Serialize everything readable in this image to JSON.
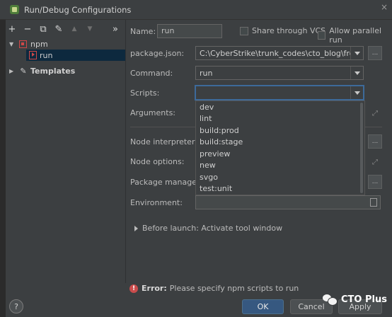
{
  "window": {
    "title": "Run/Debug Configurations",
    "close": "×"
  },
  "toolbar": {
    "add": "+",
    "remove": "−",
    "copy": "⧉",
    "edit": "✎",
    "up": "▲",
    "down": "▼",
    "more": "»"
  },
  "tree": {
    "group_label": "npm",
    "config_label": "run",
    "templates_label": "Templates"
  },
  "form": {
    "name_label": "Name:",
    "name_value": "run",
    "share_label": "Share through VCS",
    "parallel_label": "Allow parallel run",
    "package_json_label": "package.json:",
    "package_json_value": "C:\\CyberStrike\\trunk_codes\\cto_blog\\frontend\\p",
    "command_label": "Command:",
    "command_value": "run",
    "scripts_label": "Scripts:",
    "scripts_value": "",
    "arguments_label": "Arguments:",
    "node_interpreter_label": "Node interpreter:",
    "node_options_label": "Node options:",
    "package_manager_label": "Package manager:",
    "environment_label": "Environment:",
    "browse": "..."
  },
  "scripts_options": [
    "dev",
    "lint",
    "build:prod",
    "build:stage",
    "preview",
    "new",
    "svgo",
    "test:unit"
  ],
  "before_launch": "Before launch: Activate tool window",
  "error": {
    "label": "Error:",
    "message": "Please specify npm scripts to run"
  },
  "buttons": {
    "help": "?",
    "ok": "OK",
    "cancel": "Cancel",
    "apply": "Apply"
  },
  "watermark": "CTO Plus"
}
